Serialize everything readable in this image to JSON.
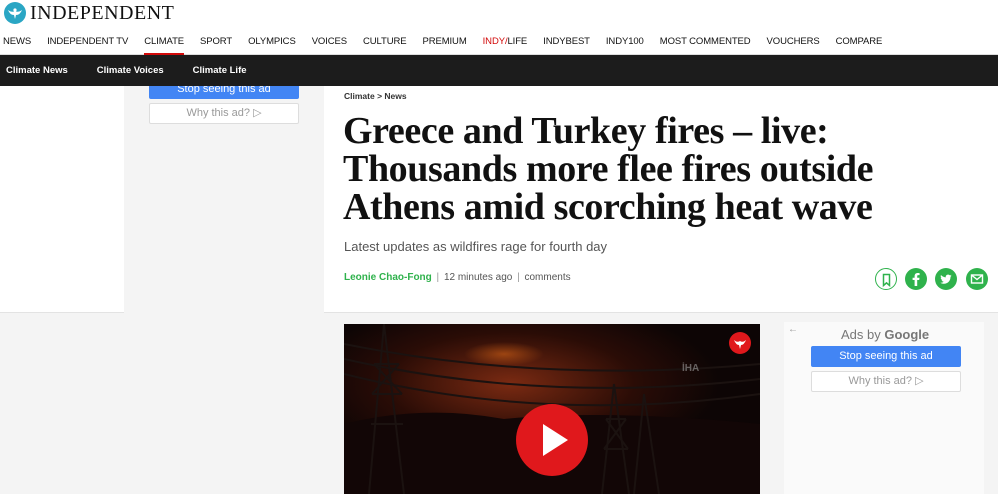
{
  "brand": {
    "name": "INDEPENDENT"
  },
  "main_nav": {
    "items": [
      {
        "label": "NEWS"
      },
      {
        "label": "INDEPENDENT TV"
      },
      {
        "label": "CLIMATE",
        "active": true
      },
      {
        "label": "SPORT"
      },
      {
        "label": "OLYMPICS"
      },
      {
        "label": "VOICES"
      },
      {
        "label": "CULTURE"
      },
      {
        "label": "PREMIUM"
      },
      {
        "label_prefix": "INDY",
        "label_suffix": "LIFE"
      },
      {
        "label": "INDYBEST"
      },
      {
        "label": "INDY100"
      },
      {
        "label": "MOST COMMENTED"
      },
      {
        "label": "VOUCHERS"
      },
      {
        "label": "COMPARE"
      }
    ]
  },
  "sub_nav": {
    "items": [
      {
        "label": "Climate News"
      },
      {
        "label": "Climate Voices"
      },
      {
        "label": "Climate Life"
      }
    ]
  },
  "left_ad": {
    "stop_label": "Stop seeing this ad",
    "why_label": "Why this ad? ▷"
  },
  "article": {
    "breadcrumb": "Climate > News",
    "headline": "Greece and Turkey fires – live: Thousands more flee fires outside Athens amid scorching heat wave",
    "standfirst": "Latest updates as wildfires rage for fourth day",
    "author": "Leonie Chao-Fong",
    "time": "12 minutes ago",
    "comments_label": "comments"
  },
  "share": {
    "icons": [
      "bookmark-icon",
      "facebook-icon",
      "twitter-icon",
      "email-icon"
    ],
    "color": "#2fb24c"
  },
  "video": {
    "watermark": "İHA"
  },
  "right_ad": {
    "back_glyph": "←",
    "ads_by": "Ads by",
    "google": "Google",
    "stop_label": "Stop seeing this ad",
    "why_label": "Why this ad? ▷"
  },
  "colors": {
    "accent_red": "#d20a0a",
    "green": "#2fb24c",
    "subnav_bg": "#1c1c1c",
    "google_blue": "#4285f4"
  }
}
